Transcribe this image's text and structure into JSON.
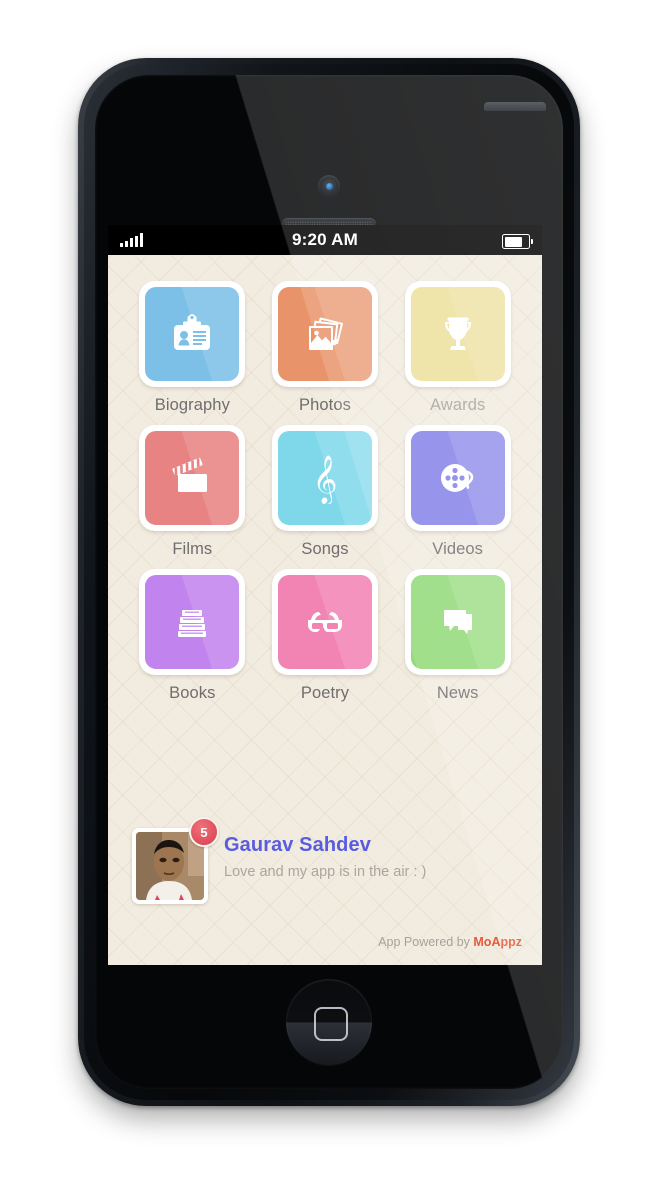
{
  "device": {
    "name": "iPhone 5 black",
    "camera_icon": "camera-lens",
    "speaker_icon": "earpiece-speaker",
    "home_button_icon": "home-button"
  },
  "status_bar": {
    "time": "9:20 AM",
    "signal_icon": "signal-bars",
    "signal_bars": 5,
    "battery_icon": "battery-full",
    "battery_level": 80
  },
  "app": {
    "background_color": "#f2ece0",
    "tiles": [
      {
        "label": "Biography",
        "icon": "id-badge-icon",
        "color": "#7cc0e8",
        "dim_label": false
      },
      {
        "label": "Photos",
        "icon": "photos-icon",
        "color": "#e8936a",
        "dim_label": false
      },
      {
        "label": "Awards",
        "icon": "trophy-icon",
        "color": "#ecdf9a",
        "dim_label": true
      },
      {
        "label": "Films",
        "icon": "clapperboard-icon",
        "color": "#e88383",
        "dim_label": false
      },
      {
        "label": "Songs",
        "icon": "treble-clef-icon",
        "color": "#7fd8ea",
        "dim_label": false
      },
      {
        "label": "Videos",
        "icon": "film-reel-icon",
        "color": "#8481e8",
        "dim_label": false
      },
      {
        "label": "Books",
        "icon": "books-stack-icon",
        "color": "#c183ed",
        "dim_label": false
      },
      {
        "label": "Poetry",
        "icon": "3d-glasses-icon",
        "color": "#f284b4",
        "dim_label": false
      },
      {
        "label": "News",
        "icon": "speech-bubbles-icon",
        "color": "#92d977",
        "dim_label": false
      }
    ],
    "profile": {
      "name": "Gaurav Sahdev",
      "name_color": "#5a5ce0",
      "status": "Love and my app is in the air : )",
      "badge_count": "5",
      "badge_color": "#e0525f",
      "avatar_icon": "user-avatar-photo"
    },
    "footer": {
      "prefix": "App Powered by ",
      "brand": "MoAppz",
      "brand_color": "#e8593a"
    }
  }
}
